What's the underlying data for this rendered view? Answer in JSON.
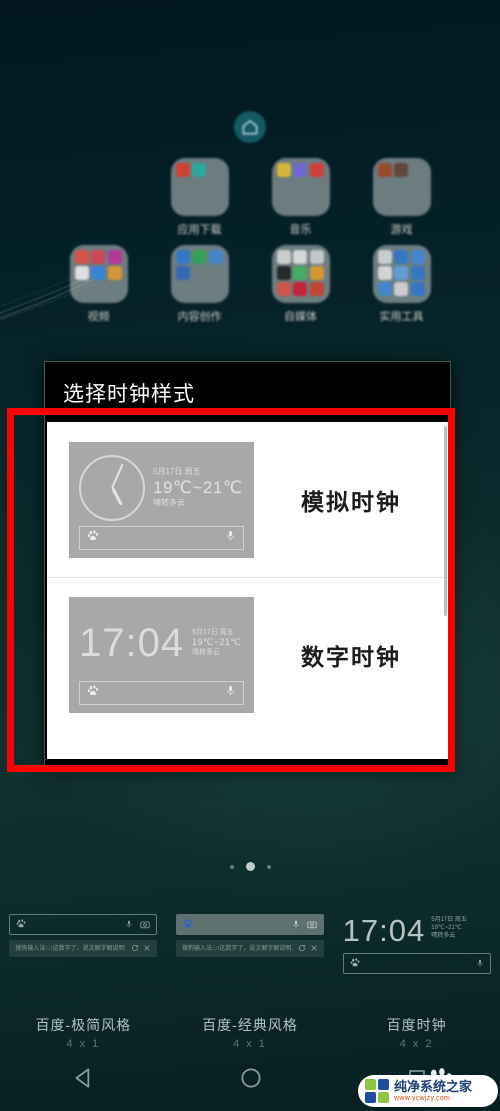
{
  "wallpaper": {
    "background_color": "#0b2a2c"
  },
  "launcher": {
    "home_icon": "home-icon",
    "folders": [
      {
        "label": "应用下载",
        "icon": "folder-icon"
      },
      {
        "label": "音乐",
        "icon": "folder-icon"
      },
      {
        "label": "游戏",
        "icon": "folder-icon"
      },
      {
        "label": "视频",
        "icon": "folder-icon"
      },
      {
        "label": "内容创作",
        "icon": "folder-icon"
      },
      {
        "label": "自媒体",
        "icon": "folder-icon"
      },
      {
        "label": "实用工具",
        "icon": "folder-icon"
      }
    ]
  },
  "dialog": {
    "title": "选择时钟样式",
    "options": [
      {
        "label": "模拟时钟",
        "preview_type": "analog",
        "time": "",
        "date": "5月17日 周五",
        "temperature": "19℃~21℃",
        "condition": "晴转多云",
        "search_left_icon": "baidu-paw-icon",
        "search_right_icon": "microphone-icon"
      },
      {
        "label": "数字时钟",
        "preview_type": "digital",
        "time": "17:04",
        "date": "5月17日 周五",
        "temperature": "19℃~21℃",
        "condition": "晴转多云",
        "search_left_icon": "baidu-paw-icon",
        "search_right_icon": "microphone-icon"
      }
    ]
  },
  "annotation": {
    "highlight_color": "#fd0000",
    "shape": "rectangle"
  },
  "page_indicator": {
    "total": 3,
    "active_index": 1
  },
  "widget_tray": {
    "widgets": [
      {
        "name": "百度-极简风格",
        "size": "4 x 1",
        "search_hint": "搜狗输入法া这数字了，说文解字解说明…",
        "icons": [
          "baidu-paw-icon",
          "microphone-icon",
          "camera-icon"
        ]
      },
      {
        "name": "百度-经典风格",
        "size": "4 x 1",
        "search_hint": "搜狗输入法া这数字了，说文解字解说明…",
        "icons": [
          "baidu-logo-icon",
          "microphone-icon",
          "camera-icon"
        ]
      },
      {
        "name": "百度时钟",
        "size": "4 x 2",
        "time": "17:04",
        "date": "5月17日 周五",
        "temperature": "19℃~21℃",
        "condition": "晴转多云",
        "icons": [
          "baidu-paw-icon",
          "microphone-icon"
        ]
      }
    ]
  },
  "navbar": {
    "buttons": [
      {
        "name": "back",
        "icon": "back-triangle-icon"
      },
      {
        "name": "home",
        "icon": "home-circle-icon"
      },
      {
        "name": "recents",
        "icon": "recents-square-icon"
      }
    ]
  },
  "watermark": {
    "title": "纯净系统之家",
    "url": "www.ycwjzy.com"
  }
}
